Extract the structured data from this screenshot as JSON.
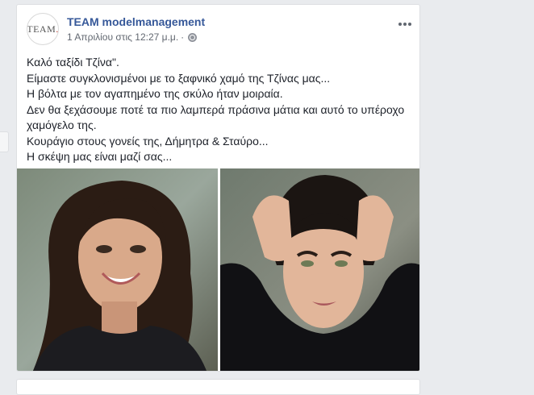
{
  "post": {
    "page_name": "TEAM modelmanagement",
    "timestamp": "1 Απριλίου στις 12:27 μ.μ.",
    "separator": "·",
    "privacy_icon": "globe-icon",
    "more_icon": "more-options-icon",
    "avatar": {
      "text": "TEAM",
      "dot": "."
    },
    "text_lines": [
      "Καλό ταξίδι Τζίνα\".",
      "Είμαστε συγκλονισμένοι με το ξαφνικό χαμό της Τζίνας μας...",
      "Η βόλτα με τον αγαπημένο της σκύλο ήταν μοιραία.",
      "Δεν θα ξεχάσουμε ποτέ τα πιο λαμπερά πράσινα μάτια και αυτό το υπέροχο",
      "χαμόγελο της.",
      "Κουράγιο στους γονείς της, Δήμητρα & Σταύρο...",
      "Η σκέψη μας είναι μαζί σας..."
    ]
  },
  "colors": {
    "link": "#365899",
    "text": "#1d2129",
    "meta": "#616770",
    "background": "#e9ebee"
  }
}
